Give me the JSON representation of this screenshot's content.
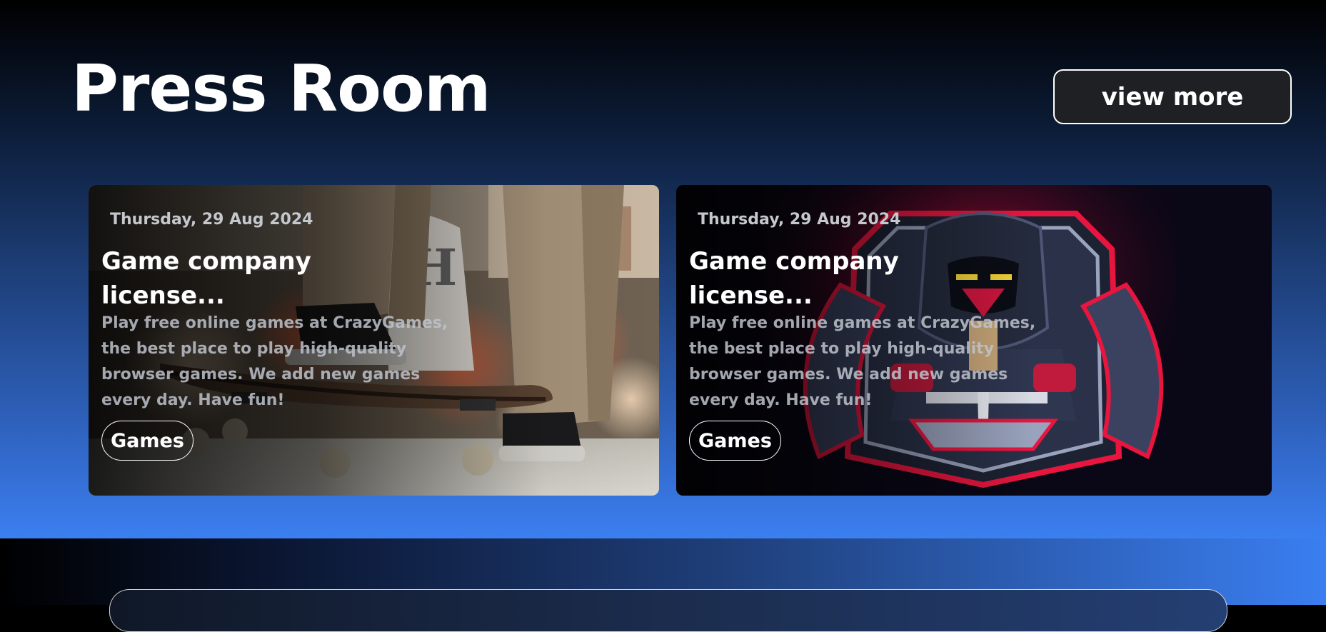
{
  "press_room": {
    "title": "Press Room",
    "view_more_label": "view more",
    "cards": [
      {
        "image": "skateboarder-photo",
        "date": "Thursday, 29 Aug 2024",
        "title": "Game company license...",
        "description": "Play free online games at CrazyGames, the best place to play high-quality browser games. We add new games every day. Have fun!",
        "tag": "Games"
      },
      {
        "image": "hooded-warrior-esports-logo",
        "date": "Thursday, 29 Aug 2024",
        "title": "Game company license...",
        "description": "Play free online games at CrazyGames, the best place to play high-quality browser games. We add new games every day. Have fun!",
        "tag": "Games"
      }
    ]
  },
  "colors": {
    "section_gradient_top": "#000000",
    "section_gradient_bottom": "#3b7ff0",
    "button_bg": "#1f2024",
    "accent_red": "#e8163f"
  }
}
